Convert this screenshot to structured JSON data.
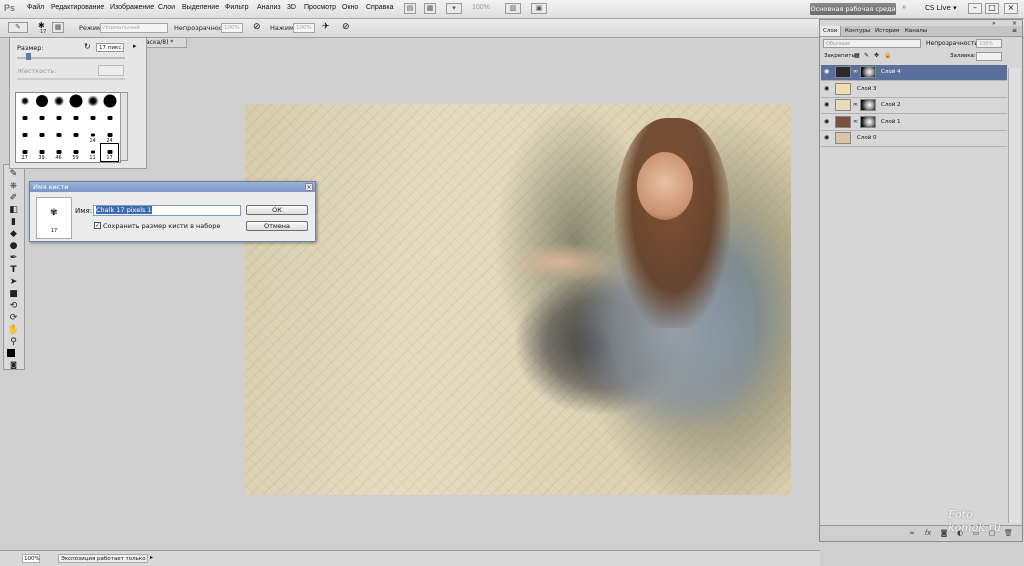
{
  "app": {
    "logo": "Ps"
  },
  "menu": [
    "Файл",
    "Редактирование",
    "Изображение",
    "Слои",
    "Выделение",
    "Фильтр",
    "Анализ",
    "3D",
    "Просмотр",
    "Окно",
    "Справка"
  ],
  "zoom_display": "100%",
  "workspace_button": "Основная рабочая среда",
  "cs_live": "CS Live ▾",
  "options_bar": {
    "brush_size": "17",
    "mode_label": "Режим:",
    "mode_value": "Нормальный",
    "opacity_label": "Непрозрачность:",
    "opacity_value": "100%",
    "pressure_label": "Нажим:",
    "pressure_value": "100%"
  },
  "document_tab": "аска/8) *",
  "brush_panel": {
    "size_label": "Размер:",
    "size_value": "17 пикс.",
    "hardness_label": "Жесткость:",
    "brushes": [
      {
        "num": "",
        "kind": "soft",
        "d": 8
      },
      {
        "num": "",
        "kind": "hard",
        "d": 12
      },
      {
        "num": "",
        "kind": "soft",
        "d": 10
      },
      {
        "num": "",
        "kind": "hard",
        "d": 13
      },
      {
        "num": "",
        "kind": "soft",
        "d": 11
      },
      {
        "num": "",
        "kind": "hard",
        "d": 13
      },
      {
        "num": "",
        "kind": "shape",
        "d": 5
      },
      {
        "num": "",
        "kind": "shape",
        "d": 5
      },
      {
        "num": "",
        "kind": "shape",
        "d": 5
      },
      {
        "num": "",
        "kind": "shape",
        "d": 5
      },
      {
        "num": "",
        "kind": "shape",
        "d": 5
      },
      {
        "num": "",
        "kind": "shape",
        "d": 5
      },
      {
        "num": "",
        "kind": "shape",
        "d": 5
      },
      {
        "num": "",
        "kind": "shape",
        "d": 5
      },
      {
        "num": "",
        "kind": "shape",
        "d": 5
      },
      {
        "num": "",
        "kind": "shape",
        "d": 5
      },
      {
        "num": "14",
        "kind": "shape",
        "d": 4
      },
      {
        "num": "24",
        "kind": "shape",
        "d": 5
      },
      {
        "num": "27",
        "kind": "shape",
        "d": 5
      },
      {
        "num": "39",
        "kind": "shape",
        "d": 5
      },
      {
        "num": "46",
        "kind": "shape",
        "d": 5
      },
      {
        "num": "59",
        "kind": "shape",
        "d": 5
      },
      {
        "num": "11",
        "kind": "shape",
        "d": 4
      },
      {
        "num": "17",
        "kind": "shape",
        "d": 5
      }
    ]
  },
  "dialog": {
    "title": "Имя кисти",
    "preview_num": "17",
    "name_label": "Имя:",
    "name_value": "Chalk 17 pixels 1",
    "checkbox_label": "Сохранить размер кисти в наборе",
    "ok": "ОК",
    "cancel": "Отмена"
  },
  "layers_panel": {
    "tabs": [
      "Слои",
      "Контуры",
      "История",
      "Каналы"
    ],
    "blend_mode": "Обычные",
    "opacity_label": "Непрозрачность:",
    "opacity_value": "100%",
    "lock_label": "Закрепить:",
    "fill_label": "Заливка:",
    "layers": [
      {
        "name": "Слой 4",
        "selected": true,
        "thumb_color": "#2a2a2a",
        "mask": true
      },
      {
        "name": "Слой 3",
        "selected": false,
        "thumb_color": "#f1deb0",
        "mask": false
      },
      {
        "name": "Слой 2",
        "selected": false,
        "thumb_color": "#eadbb8",
        "mask": true
      },
      {
        "name": "Слой 1",
        "selected": false,
        "thumb_color": "#7a5040",
        "mask": true
      },
      {
        "name": "Слой 0",
        "selected": false,
        "thumb_color": "#d9c4a8",
        "mask": false
      }
    ]
  },
  "status": {
    "zoom": "100%",
    "text": "Экспозиция работает только в ..."
  },
  "watermark": "Foto komok.ru"
}
